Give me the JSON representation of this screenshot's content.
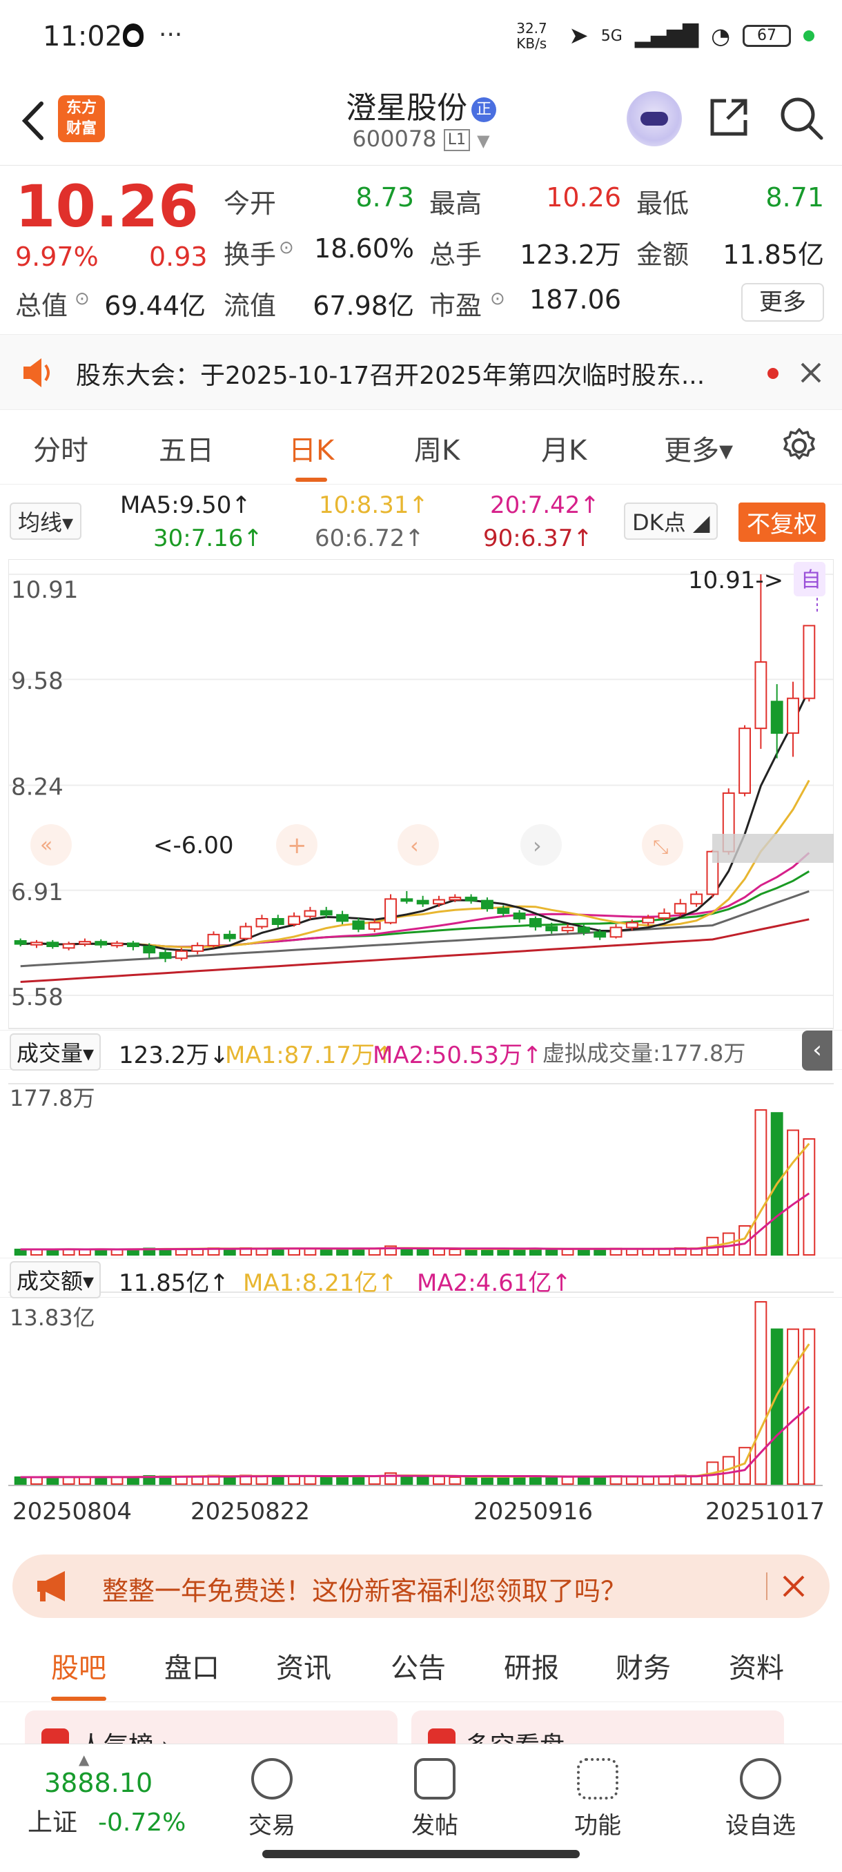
{
  "status": {
    "time": "11:02",
    "dots": "···",
    "net_speed": "32.7 KB/s",
    "signal": "5G",
    "battery": "67"
  },
  "header": {
    "back": "back",
    "logo_text_1": "东方",
    "logo_text_2": "财富",
    "stock_name": "澄星股份",
    "badge": "正",
    "code": "600078",
    "level": "L1"
  },
  "quote": {
    "price": "10.26",
    "change_pct": "9.97%",
    "change_amt": "0.93",
    "rows": [
      [
        {
          "k": "今开",
          "v": "8.73",
          "c": "green"
        },
        {
          "k": "最高",
          "v": "10.26",
          "c": "red"
        },
        {
          "k": "最低",
          "v": "8.71",
          "c": "green"
        }
      ],
      [
        {
          "k": "换手",
          "v": "18.60%",
          "c": "dark"
        },
        {
          "k": "总手",
          "v": "123.2万",
          "c": "dark"
        },
        {
          "k": "金额",
          "v": "11.85亿",
          "c": "dark"
        }
      ],
      [
        {
          "k": "总值",
          "v": "69.44亿",
          "c": "dark"
        },
        {
          "k": "流值",
          "v": "67.98亿",
          "c": "dark"
        },
        {
          "k": "市盈",
          "v": "187.06",
          "c": "dark"
        }
      ]
    ],
    "more": "更多"
  },
  "notice": {
    "text": "股东大会：于2025-10-17召开2025年第四次临时股东..."
  },
  "tabs": [
    "分时",
    "五日",
    "日K",
    "周K",
    "月K",
    "更多▾"
  ],
  "active_tab": 2,
  "ma": {
    "selector": "均线▾",
    "ma5": "MA5:9.50↑",
    "ma10": "10:8.31↑",
    "ma20": "20:7.42↑",
    "ma30": "30:7.16↑",
    "ma60": "60:6.72↑",
    "ma90": "90:6.37↑",
    "dk": "DK点",
    "fq": "不复权"
  },
  "chart_labels": {
    "y_ticks": [
      "10.91",
      "9.58",
      "8.24",
      "6.91",
      "5.58"
    ],
    "high_mark": "10.91->",
    "low_mark": "<-6.00",
    "self": "自"
  },
  "volume": {
    "selector": "成交量▾",
    "value": "123.2万↓",
    "ma1": "MA1:87.17万↑",
    "ma2": "MA2:50.53万↑",
    "virtual": "虚拟成交量:177.8万",
    "max": "177.8万"
  },
  "amount": {
    "selector": "成交额▾",
    "value": "11.85亿↑",
    "ma1": "MA1:8.21亿↑",
    "ma2": "MA2:4.61亿↑",
    "max": "13.83亿"
  },
  "dates": [
    "20250804",
    "20250822",
    "20250916",
    "20251017"
  ],
  "promo": {
    "text": "整整一年免费送！这份新客福利您领取了吗？"
  },
  "bottom_tabs": [
    "股吧",
    "盘口",
    "资讯",
    "公告",
    "研报",
    "财务",
    "资料"
  ],
  "peek": [
    "人气榜 ›",
    "多空看盘"
  ],
  "navbar": {
    "index_value": "3888.10",
    "index_name": "上证",
    "index_change": "-0.72%",
    "items": [
      "交易",
      "发帖",
      "功能",
      "设自选"
    ]
  },
  "colors": {
    "up": "#e0302b",
    "down": "#179b2c",
    "accent": "#e8651f",
    "ma5": "#222222",
    "ma10": "#e8b630",
    "ma20": "#d6208a",
    "ma30": "#1a9a23",
    "ma60": "#666666",
    "ma90": "#c0202a"
  },
  "chart_data": {
    "type": "candlestick",
    "y_ticks": [
      10.91,
      9.58,
      8.24,
      6.91,
      5.58
    ],
    "ylim": [
      5.58,
      10.91
    ],
    "x_labels": [
      "20250804",
      "20250822",
      "20250916",
      "20251017"
    ],
    "candles": [
      [
        6.27,
        6.23,
        6.3,
        6.2
      ],
      [
        6.22,
        6.25,
        6.28,
        6.18
      ],
      [
        6.25,
        6.2,
        6.28,
        6.17
      ],
      [
        6.18,
        6.23,
        6.26,
        6.15
      ],
      [
        6.23,
        6.26,
        6.3,
        6.2
      ],
      [
        6.26,
        6.22,
        6.29,
        6.18
      ],
      [
        6.21,
        6.24,
        6.27,
        6.18
      ],
      [
        6.24,
        6.2,
        6.27,
        6.15
      ],
      [
        6.2,
        6.12,
        6.24,
        6.05
      ],
      [
        6.12,
        6.05,
        6.16,
        6.0
      ],
      [
        6.05,
        6.14,
        6.18,
        6.02
      ],
      [
        6.14,
        6.21,
        6.25,
        6.1
      ],
      [
        6.21,
        6.35,
        6.39,
        6.18
      ],
      [
        6.35,
        6.3,
        6.4,
        6.26
      ],
      [
        6.3,
        6.45,
        6.5,
        6.28
      ],
      [
        6.45,
        6.55,
        6.6,
        6.42
      ],
      [
        6.55,
        6.48,
        6.6,
        6.44
      ],
      [
        6.48,
        6.58,
        6.63,
        6.45
      ],
      [
        6.58,
        6.65,
        6.7,
        6.54
      ],
      [
        6.65,
        6.6,
        6.7,
        6.56
      ],
      [
        6.6,
        6.52,
        6.65,
        6.48
      ],
      [
        6.52,
        6.42,
        6.56,
        6.38
      ],
      [
        6.42,
        6.5,
        6.55,
        6.38
      ],
      [
        6.5,
        6.8,
        6.86,
        6.48
      ],
      [
        6.8,
        6.78,
        6.9,
        6.74
      ],
      [
        6.78,
        6.74,
        6.84,
        6.7
      ],
      [
        6.74,
        6.79,
        6.84,
        6.7
      ],
      [
        6.79,
        6.82,
        6.86,
        6.76
      ],
      [
        6.82,
        6.78,
        6.86,
        6.74
      ],
      [
        6.78,
        6.68,
        6.82,
        6.64
      ],
      [
        6.68,
        6.62,
        6.72,
        6.58
      ],
      [
        6.62,
        6.55,
        6.66,
        6.5
      ],
      [
        6.55,
        6.45,
        6.58,
        6.4
      ],
      [
        6.45,
        6.4,
        6.5,
        6.36
      ],
      [
        6.4,
        6.44,
        6.48,
        6.37
      ],
      [
        6.44,
        6.38,
        6.48,
        6.34
      ],
      [
        6.38,
        6.32,
        6.42,
        6.28
      ],
      [
        6.32,
        6.44,
        6.48,
        6.3
      ],
      [
        6.44,
        6.5,
        6.54,
        6.4
      ],
      [
        6.5,
        6.56,
        6.6,
        6.46
      ],
      [
        6.56,
        6.62,
        6.68,
        6.52
      ],
      [
        6.62,
        6.74,
        6.8,
        6.58
      ],
      [
        6.74,
        6.86,
        6.9,
        6.7
      ],
      [
        6.86,
        7.4,
        7.42,
        6.82
      ],
      [
        7.4,
        8.14,
        8.2,
        7.36
      ],
      [
        8.14,
        8.96,
        9.0,
        8.1
      ],
      [
        8.96,
        9.8,
        10.91,
        8.7
      ],
      [
        9.3,
        8.9,
        9.52,
        8.58
      ],
      [
        8.9,
        9.34,
        9.55,
        8.6
      ],
      [
        9.34,
        10.26,
        10.26,
        9.3
      ]
    ],
    "volume_max": "177.8万",
    "amount_max": "13.83亿"
  }
}
